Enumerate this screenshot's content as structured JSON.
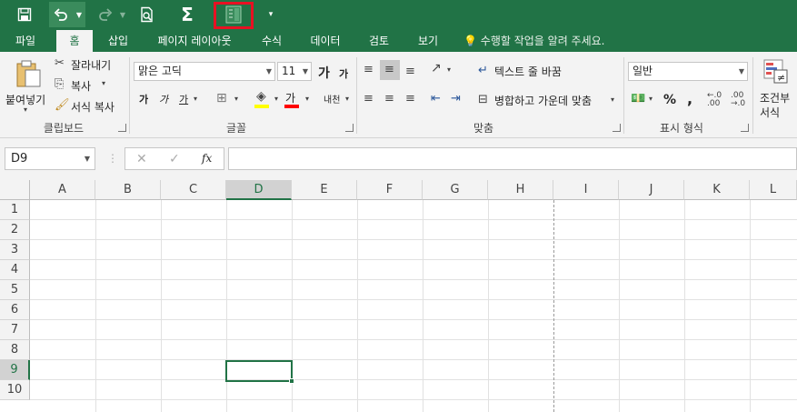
{
  "qat": {
    "save_icon": "save-icon",
    "undo_icon": "undo-icon",
    "redo_icon": "redo-icon",
    "print_preview_icon": "print-preview-icon",
    "autosum_symbol": "Σ",
    "customize_icon": "customize-qat-icon"
  },
  "tabs": [
    {
      "label": "파일"
    },
    {
      "label": "홈"
    },
    {
      "label": "삽입"
    },
    {
      "label": "페이지 레이아웃"
    },
    {
      "label": "수식"
    },
    {
      "label": "데이터"
    },
    {
      "label": "검토"
    },
    {
      "label": "보기"
    }
  ],
  "tell_me": "수행할 작업을 알려 주세요.",
  "clipboard": {
    "paste": "붙여넣기",
    "cut": "잘라내기",
    "copy": "복사",
    "format_painter": "서식 복사",
    "group": "클립보드"
  },
  "font": {
    "name": "맑은 고딕",
    "size": "11",
    "grow": "가",
    "shrink": "가",
    "bold": "가",
    "italic": "가",
    "underline": "가",
    "font_color": "가",
    "phonetic": "내천",
    "group": "글꼴"
  },
  "alignment": {
    "wrap_text": "텍스트 줄 바꿈",
    "merge_center": "병합하고 가운데 맞춤",
    "group": "맞춤"
  },
  "number": {
    "format": "일반",
    "percent": "%",
    "comma": ",",
    "group": "표시 형식"
  },
  "styles": {
    "conditional_line1": "조건부",
    "conditional_line2": "서식"
  },
  "formula_bar": {
    "name_box": "D9",
    "fx": "fx",
    "value": ""
  },
  "columns": [
    "A",
    "B",
    "C",
    "D",
    "E",
    "F",
    "G",
    "H",
    "I",
    "J",
    "K",
    "L"
  ],
  "rows": [
    "1",
    "2",
    "3",
    "4",
    "5",
    "6",
    "7",
    "8",
    "9",
    "10"
  ],
  "selected_cell": "D9",
  "colors": {
    "accent": "#217346",
    "highlight_box": "#e81123",
    "fill_color": "#ffff00",
    "font_color": "#ff0000"
  }
}
